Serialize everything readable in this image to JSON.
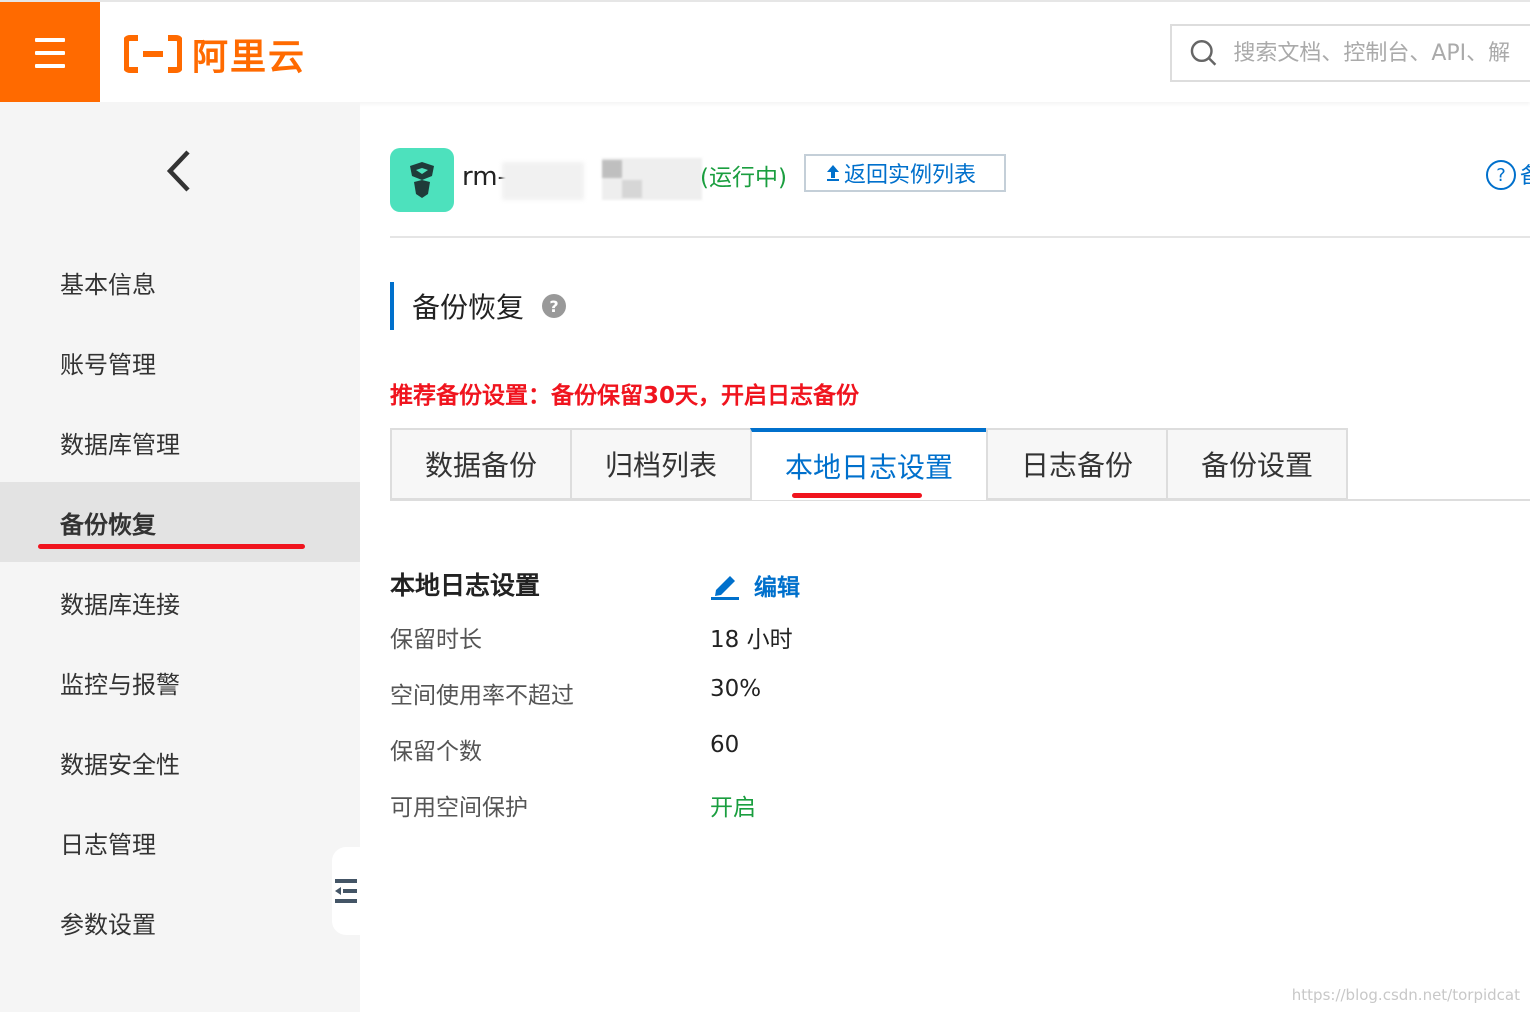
{
  "topbar": {
    "logo_text": "阿里云",
    "search_placeholder": "搜索文档、控制台、API、解",
    "brand_color": "#ff6a00"
  },
  "sidebar": {
    "items": [
      {
        "label": "基本信息"
      },
      {
        "label": "账号管理"
      },
      {
        "label": "数据库管理"
      },
      {
        "label": "备份恢复",
        "active": true
      },
      {
        "label": "数据库连接"
      },
      {
        "label": "监控与报警"
      },
      {
        "label": "数据安全性"
      },
      {
        "label": "日志管理"
      },
      {
        "label": "参数设置"
      }
    ]
  },
  "instance": {
    "name_prefix": "rm-",
    "status": "(运行中)",
    "back_button_label": "返回实例列表",
    "help_label": "?",
    "help_cut": "备"
  },
  "page": {
    "section_title": "备份恢复",
    "recommendation": "推荐备份设置：备份保留30天，开启日志备份"
  },
  "tabs": [
    {
      "label": "数据备份"
    },
    {
      "label": "归档列表"
    },
    {
      "label": "本地日志设置",
      "active": true
    },
    {
      "label": "日志备份"
    },
    {
      "label": "备份设置"
    }
  ],
  "local_log_settings": {
    "title": "本地日志设置",
    "edit_label": "编辑",
    "rows": [
      {
        "label": "保留时长",
        "value": "18 小时"
      },
      {
        "label": "空间使用率不超过",
        "value": "30%"
      },
      {
        "label": "保留个数",
        "value": "60"
      },
      {
        "label": "可用空间保护",
        "value": "开启"
      }
    ]
  },
  "watermark": "https://blog.csdn.net/torpidcat",
  "colors": {
    "accent_blue": "#0070cc",
    "status_green": "#1a9e3f",
    "warning_red": "#f0141e"
  }
}
